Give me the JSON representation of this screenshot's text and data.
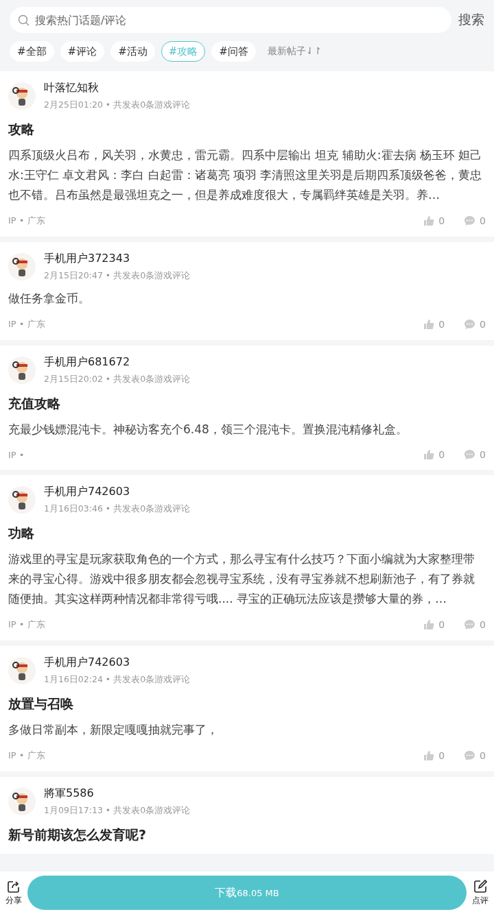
{
  "search": {
    "placeholder": "搜索热门话题/评论",
    "button": "搜索"
  },
  "filters": [
    {
      "label": "#全部",
      "selected": false
    },
    {
      "label": "#评论",
      "selected": false
    },
    {
      "label": "#活动",
      "selected": false
    },
    {
      "label": "#攻略",
      "selected": true
    },
    {
      "label": "#问答",
      "selected": false
    }
  ],
  "sort": {
    "label": "最新帖子",
    "icon": "⇃↾"
  },
  "posts": [
    {
      "user": "叶落忆知秋",
      "meta": "2月25日01:20 • 共发表0条游戏评论",
      "title": "攻略",
      "body": "四系顶级火吕布，风关羽，水黄忠，雷元霸。四系中层输出 坦克 辅助火:霍去病 杨玉环 妲己水:王守仁 卓文君风：李白 白起雷：诸葛亮 项羽 李清照这里关羽是后期四系顶级爸爸，黄忠也不错。吕布虽然是最强坦克之一，但是养成难度很大，专属羁绊英雄是关羽。养…",
      "ip": "IP • 广东",
      "likes": "0",
      "comments": "0"
    },
    {
      "user": "手机用户372343",
      "meta": "2月15日20:47 • 共发表0条游戏评论",
      "body": "做任务拿金币。",
      "ip": "IP • 广东",
      "likes": "0",
      "comments": "0"
    },
    {
      "user": "手机用户681672",
      "meta": "2月15日20:02 • 共发表0条游戏评论",
      "title": "充值攻略",
      "body": "充最少钱嫖混沌卡。神秘访客充个6.48，领三个混沌卡。置换混沌精修礼盒。",
      "ip": "IP •",
      "likes": "0",
      "comments": "0"
    },
    {
      "user": "手机用户742603",
      "meta": "1月16日03:46 • 共发表0条游戏评论",
      "title": "功略",
      "body": "游戏里的寻宝是玩家获取角色的一个方式，那么寻宝有什么技巧？下面小编就为大家整理带来的寻宝心得。游戏中很多朋友都会忽视寻宝系统，没有寻宝券就不想刷新池子，有了券就随便抽。其实这样两种情况都非常得亏哦.... 寻宝的正确玩法应该是攒够大量的券，…",
      "ip": "IP • 广东",
      "likes": "0",
      "comments": "0"
    },
    {
      "user": "手机用户742603",
      "meta": "1月16日02:24 • 共发表0条游戏评论",
      "title": "放置与召唤",
      "body": "多做日常副本，新限定嘎嘎抽就完事了，",
      "ip": "IP • 广东",
      "likes": "0",
      "comments": "0"
    },
    {
      "user": "將軍5586",
      "meta": "1月09日17:13 • 共发表0条游戏评论",
      "title": "新号前期该怎么发育呢?"
    }
  ],
  "bottom_bar": {
    "share": "分享",
    "download": "下载",
    "size": "68.05 MB",
    "review": "点评"
  }
}
